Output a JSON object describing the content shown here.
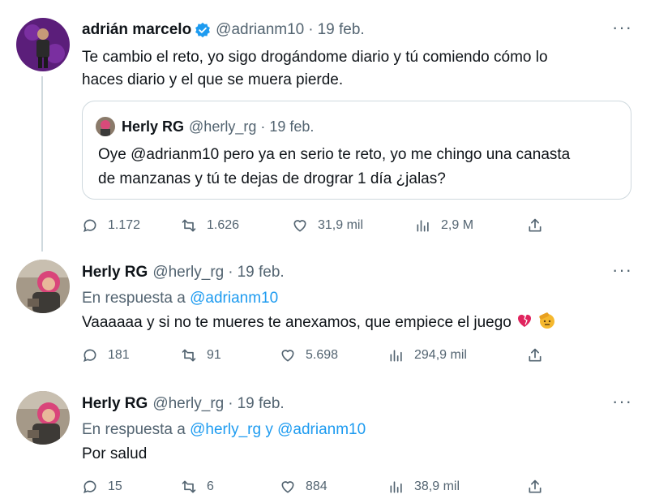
{
  "tweets": [
    {
      "name": "adrián marcelo",
      "handle": "@adrianm10",
      "separator": "·",
      "date": "19 feb.",
      "text_line1": "Te cambio el reto, yo sigo drogándome diario y tú comiendo cómo lo",
      "text_line2": "haces diario y el que se muera pierde.",
      "quote": {
        "name": "Herly RG",
        "handle": "@herly_rg",
        "date": "19 feb.",
        "text_line1": "Oye @adrianm10 pero ya en serio te reto, yo me chingo una canasta",
        "text_line2": "de manzanas y tú te dejas de drograr 1 día ¿jalas?"
      },
      "stats": {
        "replies": "1.172",
        "retweets": "1.626",
        "likes": "31,9 mil",
        "views": "2,9 M"
      }
    },
    {
      "name": "Herly RG",
      "handle": "@herly_rg",
      "separator": "·",
      "date": "19 feb.",
      "reply_prefix": "En respuesta a",
      "reply_mention1": "@adrianm10",
      "text": "Vaaaaaa y si no te mueres te anexamos, que empiece el juego",
      "stats": {
        "replies": "181",
        "retweets": "91",
        "likes": "5.698",
        "views": "294,9 mil"
      }
    },
    {
      "name": "Herly RG",
      "handle": "@herly_rg",
      "separator": "·",
      "date": "19 feb.",
      "reply_prefix": "En respuesta a",
      "reply_mention1": "@herly_rg",
      "reply_joiner": "y",
      "reply_mention2": "@adrianm10",
      "text": "Por salud",
      "stats": {
        "replies": "15",
        "retweets": "6",
        "likes": "884",
        "views": "38,9 mil"
      }
    }
  ],
  "more_label": "···",
  "icons": {
    "verified": "verified-badge-icon",
    "reply": "reply-icon",
    "retweet": "retweet-icon",
    "like": "heart-icon",
    "views": "views-chart-icon",
    "share": "share-icon",
    "more": "more-icon"
  },
  "colors": {
    "accent": "#1d9bf0",
    "muted": "#536471",
    "text": "#0f1419",
    "border": "#cfd9de"
  }
}
